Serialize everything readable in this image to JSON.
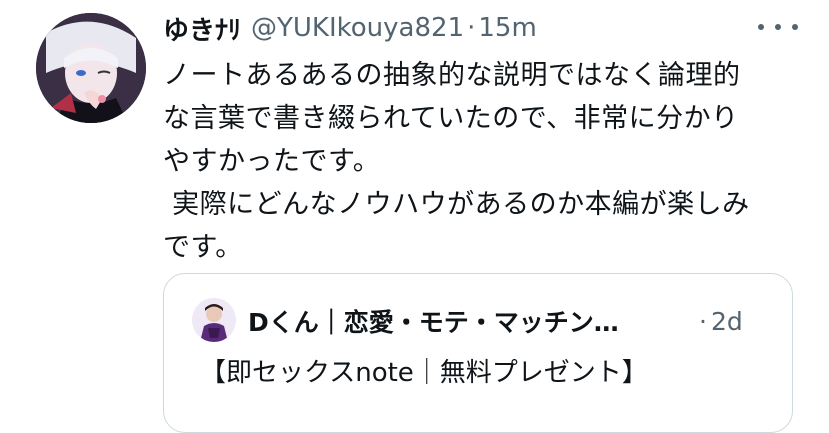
{
  "tweet": {
    "display_name": "ゆきﾅﾘ",
    "handle": "@YUKIkouya821",
    "separator": "·",
    "time": "15m",
    "more_icon": "more-horizontal-icon",
    "text_lines": [
      "ノートあるあるの抽象的な説明ではなく論理的",
      "な言葉で書き綴られていたので、非常に分かり",
      "やすかったです。",
      " 実際にどんなノウハウがあるのか本編が楽しみ",
      "です。"
    ]
  },
  "quote": {
    "display_name": "Dくん｜恋愛・モテ・マッチン…",
    "separator": "·",
    "time": "2d",
    "text": "【即セックスnote｜無料プレゼント】"
  },
  "colors": {
    "text": "#0f1419",
    "secondary": "#536471",
    "border": "#cfd9de"
  }
}
